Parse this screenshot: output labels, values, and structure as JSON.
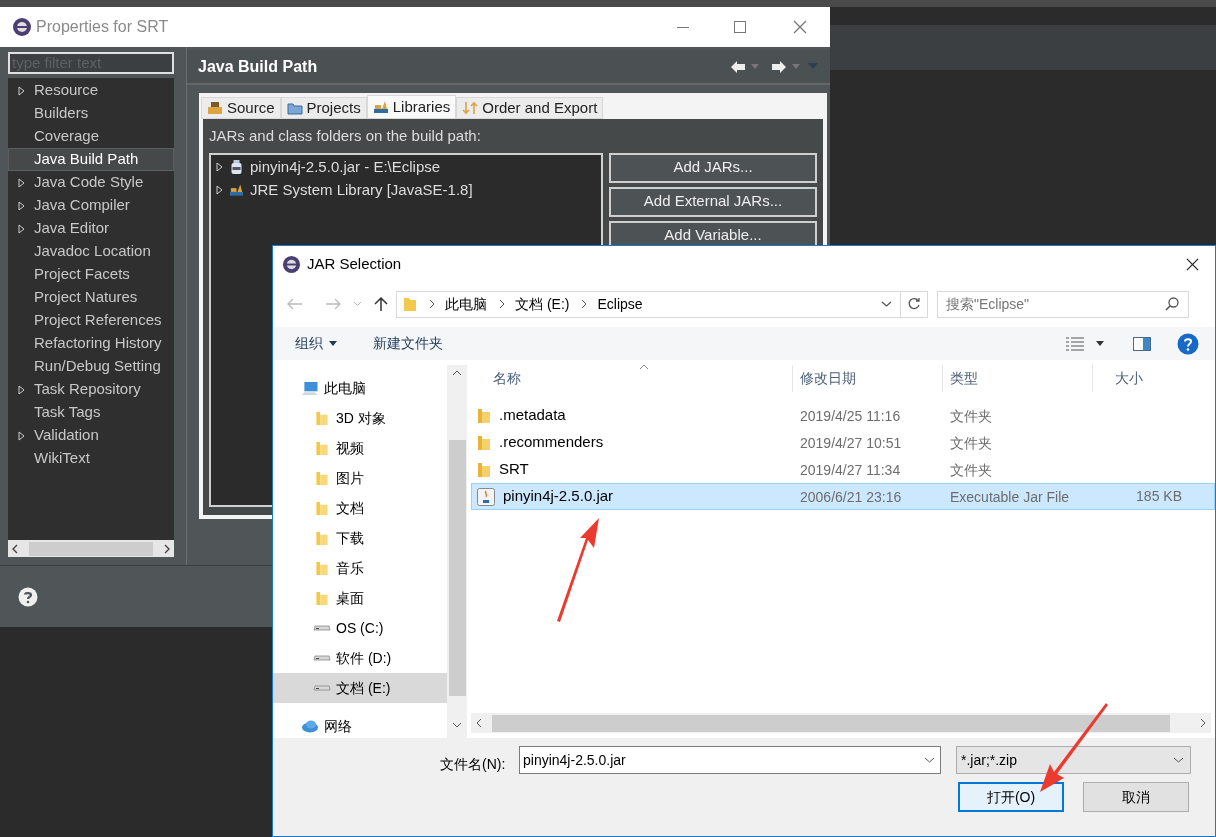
{
  "properties_window": {
    "title": "Properties for SRT",
    "filter": {
      "placeholder": "type filter text"
    },
    "tree": [
      {
        "label": "Resource",
        "expandable": true,
        "selected": false
      },
      {
        "label": "Builders",
        "expandable": false,
        "selected": false
      },
      {
        "label": "Coverage",
        "expandable": false,
        "selected": false
      },
      {
        "label": "Java Build Path",
        "expandable": false,
        "selected": true
      },
      {
        "label": "Java Code Style",
        "expandable": true,
        "selected": false
      },
      {
        "label": "Java Compiler",
        "expandable": true,
        "selected": false
      },
      {
        "label": "Java Editor",
        "expandable": true,
        "selected": false
      },
      {
        "label": "Javadoc Location",
        "expandable": false,
        "selected": false
      },
      {
        "label": "Project Facets",
        "expandable": false,
        "selected": false
      },
      {
        "label": "Project Natures",
        "expandable": false,
        "selected": false
      },
      {
        "label": "Project References",
        "expandable": false,
        "selected": false
      },
      {
        "label": "Refactoring History",
        "expandable": false,
        "selected": false
      },
      {
        "label": "Run/Debug Setting",
        "expandable": false,
        "selected": false
      },
      {
        "label": "Task Repository",
        "expandable": true,
        "selected": false
      },
      {
        "label": "Task Tags",
        "expandable": false,
        "selected": false
      },
      {
        "label": "Validation",
        "expandable": true,
        "selected": false
      },
      {
        "label": "WikiText",
        "expandable": false,
        "selected": false
      }
    ],
    "page_title": "Java Build Path",
    "tabs": [
      {
        "label": "Source",
        "kind": "source",
        "selected": false
      },
      {
        "label": "Projects",
        "kind": "projects",
        "selected": false
      },
      {
        "label": "Libraries",
        "kind": "libraries",
        "selected": true
      },
      {
        "label": "Order and Export",
        "kind": "order",
        "selected": false
      }
    ],
    "list_label": "JARs and class folders on the build path:",
    "entries": [
      {
        "label": "pinyin4j-2.5.0.jar - E:\\Eclipse",
        "kind": "jar"
      },
      {
        "label": "JRE System Library [JavaSE-1.8]",
        "kind": "library"
      }
    ],
    "buttons": [
      "Add JARs...",
      "Add External JARs...",
      "Add Variable..."
    ]
  },
  "jar_dialog": {
    "title": "JAR Selection",
    "breadcrumb": [
      "此电脑",
      "文档 (E:)",
      "Eclipse"
    ],
    "search": {
      "placeholder": "搜索\"Eclipse\""
    },
    "toolbar": [
      {
        "label": "组织",
        "dropdown": true
      },
      {
        "label": "新建文件夹",
        "dropdown": false
      }
    ],
    "nav": [
      {
        "label": "此电脑",
        "kind": "computer",
        "selected": false,
        "children": [
          {
            "label": "3D 对象",
            "kind": "folder",
            "selected": false
          },
          {
            "label": "视频",
            "kind": "folder",
            "selected": false
          },
          {
            "label": "图片",
            "kind": "folder",
            "selected": false
          },
          {
            "label": "文档",
            "kind": "folder",
            "selected": false
          },
          {
            "label": "下载",
            "kind": "folder",
            "selected": false
          },
          {
            "label": "音乐",
            "kind": "folder",
            "selected": false
          },
          {
            "label": "桌面",
            "kind": "folder",
            "selected": false
          },
          {
            "label": "OS (C:)",
            "kind": "drive",
            "selected": false
          },
          {
            "label": "软件 (D:)",
            "kind": "drive",
            "selected": false
          },
          {
            "label": "文档 (E:)",
            "kind": "drive",
            "selected": true
          }
        ]
      },
      {
        "label": "网络",
        "kind": "network",
        "selected": false
      }
    ],
    "columns": [
      "名称",
      "修改日期",
      "类型",
      "大小"
    ],
    "rows": [
      {
        "name": ".metadata",
        "date": "2019/4/25 11:16",
        "type": "文件夹",
        "kind": "folder",
        "selected": false
      },
      {
        "name": ".recommenders",
        "date": "2019/4/27 10:51",
        "type": "文件夹",
        "kind": "folder",
        "selected": false
      },
      {
        "name": "SRT",
        "date": "2019/4/27 11:34",
        "type": "文件夹",
        "kind": "folder",
        "selected": false
      },
      {
        "name": "pinyin4j-2.5.0.jar",
        "date": "2006/6/21 23:16",
        "type": "Executable Jar File",
        "size": "185 KB",
        "kind": "jar",
        "selected": true
      }
    ],
    "file_name": {
      "label": "文件名(N):",
      "value": "pinyin4j-2.5.0.jar"
    },
    "filter": "*.jar;*.zip",
    "buttons": [
      {
        "label": "打开(O)",
        "default": true
      },
      {
        "label": "取消",
        "default": false
      }
    ]
  }
}
